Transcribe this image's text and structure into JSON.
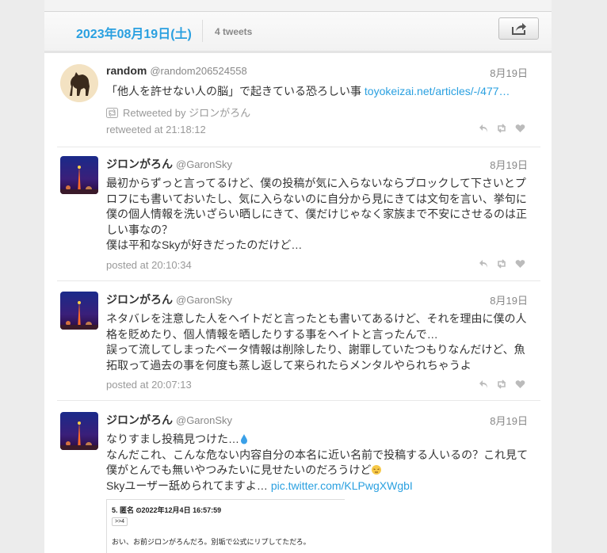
{
  "header": {
    "date": "2023年08月19日(土)",
    "count": "4 tweets",
    "share_icon": "share-icon"
  },
  "colors": {
    "accent": "#2aa0e0",
    "muted": "#999999",
    "text": "#333333"
  },
  "tweets": [
    {
      "name": "random",
      "handle": "@random206524558",
      "date": "8月19日",
      "text": "「他人を許せない人の脳」で起きている恐ろしい事 ",
      "link": "toyokeizai.net/articles/-/477…",
      "retweeted_by": "Retweeted by ジロンがろん",
      "meta": "retweeted at 21:18:12",
      "avatar_icon": "horse-avatar"
    },
    {
      "name": "ジロンがろん",
      "handle": "@GaronSky",
      "date": "8月19日",
      "lines": [
        "最初からずっと言ってるけど、僕の投稿が気に入らないならブロックして下さいとプ",
        "ロフにも書いておいたし、気に入らないのに自分から見にきては文句を言い、挙句に",
        "僕の個人情報を洗いざらい晒しにきて、僕だけじゃなく家族まで不安にさせるのは正",
        "しい事なの？",
        "僕は平和なSkyが好きだったのだけど…"
      ],
      "meta": "posted at 20:10:34",
      "avatar_icon": "night-tower-avatar"
    },
    {
      "name": "ジロンがろん",
      "handle": "@GaronSky",
      "date": "8月19日",
      "lines": [
        "ネタバレを注意した人をヘイトだと言ったとも書いてあるけど、それを理由に僕の人",
        "格を貶めたり、個人情報を晒したりする事をヘイトと言ったんで…",
        "誤って流してしまったベータ情報は削除したり、謝罪していたつもりなんだけど、魚",
        "拓取って過去の事を何度も蒸し返して来られたらメンタルやられちゃうよ"
      ],
      "meta": "posted at 20:07:13",
      "avatar_icon": "night-tower-avatar"
    },
    {
      "name": "ジロンがろん",
      "handle": "@GaronSky",
      "date": "8月19日",
      "lines": [
        "なりすまし投稿見つけた…",
        "なんだこれ、こんな危ない内容自分の本名に近い名前で投稿する人いるの？これ見て",
        "僕がとんでも無いやつみたいに見せたいのだろうけど",
        "Skyユーザー舐められてますよ… "
      ],
      "link": "pic.twitter.com/KLPwgXWgbI",
      "embed": {
        "line1": "5. 匿名 ⏲2022年12月4日 16:57:59",
        "line2": ">>4",
        "line3": "おい、お前ジロンがろんだろ。別垢で公式にリプしてただろ。"
      },
      "avatar_icon": "night-tower-avatar"
    }
  ],
  "actions": {
    "reply": "reply-icon",
    "retweet": "retweet-icon",
    "favorite": "heart-icon"
  }
}
